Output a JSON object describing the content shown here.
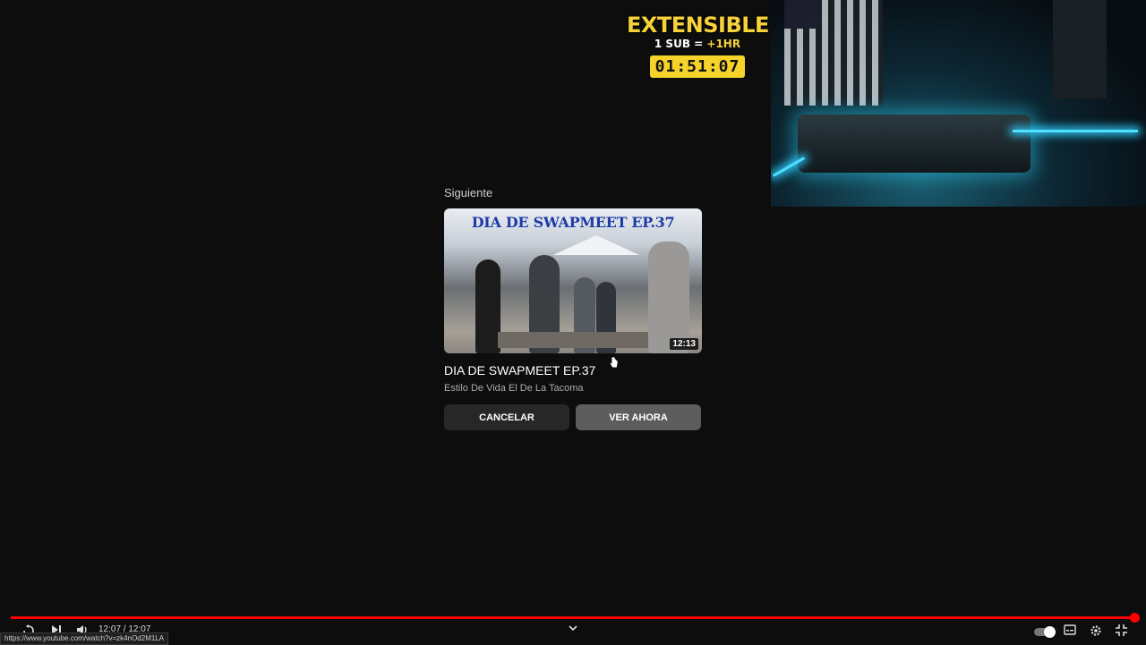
{
  "overlay": {
    "title": "EXTENSIBLE",
    "sub_prefix": "1 SUB = ",
    "sub_accent": "+1HR",
    "timer": "01:51:07"
  },
  "upnext": {
    "label": "Siguiente",
    "thumb_title": "DIA DE SWAPMEET EP.37",
    "duration": "12:13",
    "video_title": "DIA DE SWAPMEET EP.37",
    "channel": "Estilo De Vida El De La Tacoma",
    "cancel_label": "CANCELAR",
    "watch_label": "VER AHORA"
  },
  "player": {
    "time": "12:07 / 12:07",
    "url_tooltip": "https://www.youtube.com/watch?v=zk4nOd2M1LA",
    "progress": 1.0
  },
  "icons": {
    "replay": "replay-icon",
    "next": "next-icon",
    "volume": "volume-icon",
    "chevron": "chevron-down-icon",
    "autoplay": "autoplay-toggle-icon",
    "subtitles": "subtitles-icon",
    "settings": "gear-icon",
    "exit_fullscreen": "exit-fullscreen-icon"
  }
}
